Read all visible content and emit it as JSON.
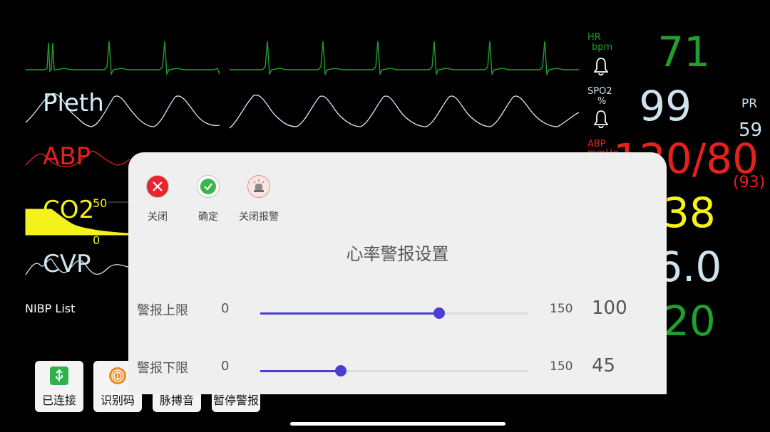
{
  "waveforms": {
    "pleth_label": "Pleth",
    "abp_label": "ABP",
    "co2_label": "CO2",
    "co2_scale_top": "50",
    "co2_scale_bottom": "0",
    "cvp_label": "CVP",
    "nibp_list": "NIBP List"
  },
  "vitals": {
    "hr_label": "HR",
    "hr_unit": "bpm",
    "hr_value": "71",
    "spo2_label": "SPO2",
    "spo2_unit": "%",
    "spo2_value": "99",
    "pr_label": "PR",
    "pr_value": "59",
    "abp_label": "ABP",
    "abp_unit": "mmHg",
    "abp_value": "120/80",
    "abp_mean": "(93)",
    "co2_value": "38",
    "cvp_value": "6.0",
    "extra_value": "20"
  },
  "colors": {
    "ecg": "#1fa02c",
    "pleth": "#d6ecf6",
    "abp": "#e5211b",
    "co2": "#f4f21a",
    "cvp": "#cfe3ee",
    "slider": "#4b3fd0"
  },
  "buttons": [
    {
      "label": "已连接",
      "icon": "usb-icon"
    },
    {
      "label": "识别码",
      "icon": "fingerprint-icon"
    },
    {
      "label": "脉搏音",
      "icon": "pulse-sound-icon"
    },
    {
      "label": "暂停警报",
      "icon": "pause-alarm-icon"
    }
  ],
  "dialog": {
    "close_label": "关闭",
    "confirm_label": "确定",
    "silence_label": "关闭报警",
    "title": "心率警报设置",
    "upper": {
      "label": "警报上限",
      "min": "0",
      "max": "150",
      "value": "100",
      "fraction": 0.667
    },
    "lower": {
      "label": "警报下限",
      "min": "0",
      "max": "150",
      "value": "45",
      "fraction": 0.3
    }
  }
}
